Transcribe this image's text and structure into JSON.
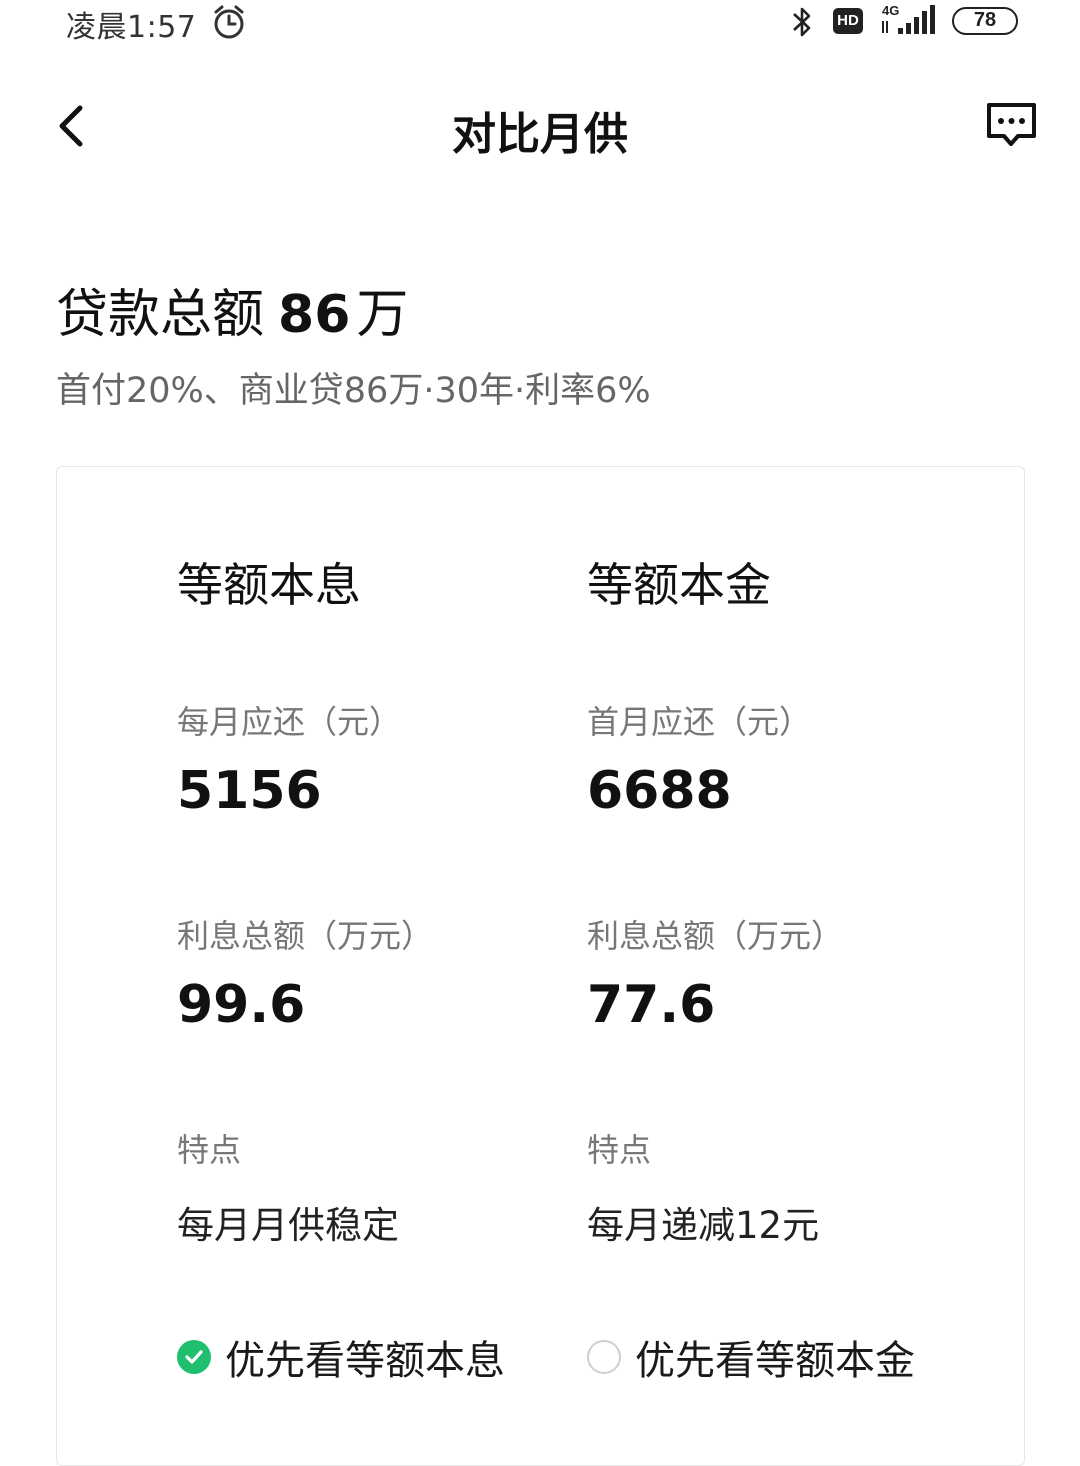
{
  "status_bar": {
    "time": "凌晨1:57",
    "hd_badge": "HD",
    "network": "4G",
    "battery": "78",
    "icons": [
      "alarm-icon",
      "bluetooth-icon",
      "hd-icon",
      "signal-icon",
      "battery-icon"
    ]
  },
  "nav": {
    "title": "对比月供",
    "back_icon": "chevron-left-icon",
    "message_icon": "message-icon"
  },
  "loan": {
    "total_prefix": "贷款总额",
    "total_amount": "86",
    "total_unit": "万",
    "description": "首付20%、商业贷86万·30年·利率6%"
  },
  "comparison": {
    "left": {
      "title": "等额本息",
      "payment_label": "每月应还（元）",
      "payment_value": "5156",
      "interest_label": "利息总额（万元）",
      "interest_value": "99.6",
      "feature_label": "特点",
      "feature_value": "每月月供稳定",
      "preference_label": "优先看等额本息",
      "selected": true
    },
    "right": {
      "title": "等额本金",
      "payment_label": "首月应还（元）",
      "payment_value": "6688",
      "interest_label": "利息总额（万元）",
      "interest_value": "77.6",
      "feature_label": "特点",
      "feature_value": "每月递减12元",
      "preference_label": "优先看等额本金",
      "selected": false
    }
  },
  "colors": {
    "accent_green": "#1fbf6f",
    "text_primary": "#111111",
    "text_secondary": "#777777"
  }
}
